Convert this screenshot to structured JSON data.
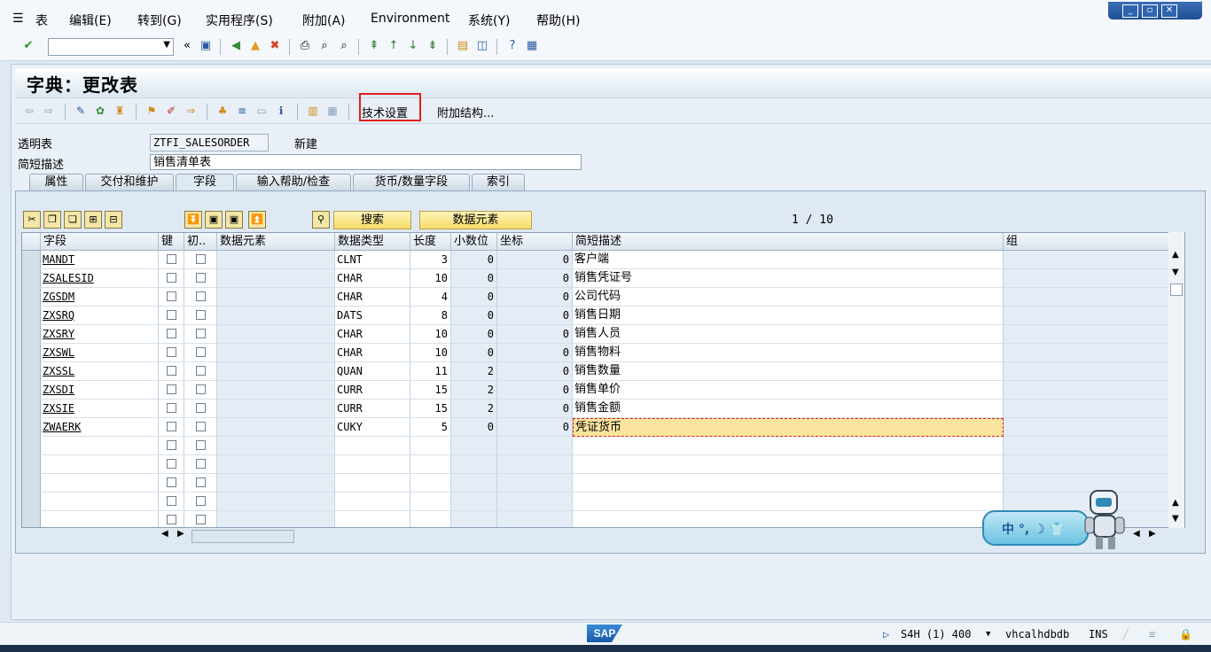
{
  "menu": [
    "表",
    "编辑(E)",
    "转到(G)",
    "实用程序(S)",
    "附加(A)",
    "Environment",
    "系统(Y)",
    "帮助(H)"
  ],
  "window_controls": {
    "minimize": "_",
    "restore": "▫",
    "close": "✕"
  },
  "toolbar": {
    "command_field": "",
    "back_label": "«"
  },
  "title": "字典：更改表",
  "app_toolbar": {
    "technical_settings": "技术设置",
    "append_structure": "附加结构..."
  },
  "header": {
    "table_label": "透明表",
    "table_name": "ZTFI_SALESORDER",
    "status": "新建",
    "desc_label": "简短描述",
    "desc_value": "销售清单表"
  },
  "tabs": [
    "属性",
    "交付和维护",
    "字段",
    "输入帮助/检查",
    "货币/数量字段",
    "索引"
  ],
  "active_tab": "字段",
  "table_controls": {
    "search": "搜索",
    "data_element": "数据元素",
    "pager": "1 / 10"
  },
  "columns": [
    "字段",
    "键",
    "初..",
    "数据元素",
    "数据类型",
    "长度",
    "小数位",
    "坐标",
    "简短描述",
    "组"
  ],
  "rows": [
    {
      "field": "MANDT",
      "type": "CLNT",
      "length": "3",
      "decimals": "0",
      "coord": "0",
      "desc": "客户端"
    },
    {
      "field": "ZSALESID",
      "type": "CHAR",
      "length": "10",
      "decimals": "0",
      "coord": "0",
      "desc": "销售凭证号"
    },
    {
      "field": "ZGSDM",
      "type": "CHAR",
      "length": "4",
      "decimals": "0",
      "coord": "0",
      "desc": "公司代码"
    },
    {
      "field": "ZXSRQ",
      "type": "DATS",
      "length": "8",
      "decimals": "0",
      "coord": "0",
      "desc": "销售日期"
    },
    {
      "field": "ZXSRY",
      "type": "CHAR",
      "length": "10",
      "decimals": "0",
      "coord": "0",
      "desc": "销售人员"
    },
    {
      "field": "ZXSWL",
      "type": "CHAR",
      "length": "10",
      "decimals": "0",
      "coord": "0",
      "desc": "销售物料"
    },
    {
      "field": "ZXSSL",
      "type": "QUAN",
      "length": "11",
      "decimals": "2",
      "coord": "0",
      "desc": "销售数量"
    },
    {
      "field": "ZXSDI",
      "type": "CURR",
      "length": "15",
      "decimals": "2",
      "coord": "0",
      "desc": "销售单价"
    },
    {
      "field": "ZXSIE",
      "type": "CURR",
      "length": "15",
      "decimals": "2",
      "coord": "0",
      "desc": "销售金额"
    },
    {
      "field": "ZWAERK",
      "type": "CUKY",
      "length": "5",
      "decimals": "0",
      "coord": "0",
      "desc": "凭证货币"
    }
  ],
  "ime_widget": {
    "text": "中 °, ☽ 👕"
  },
  "status_bar": {
    "logo": "SAP",
    "system": "S4H (1) 400",
    "host": "vhcalhdbdb",
    "mode": "INS"
  }
}
